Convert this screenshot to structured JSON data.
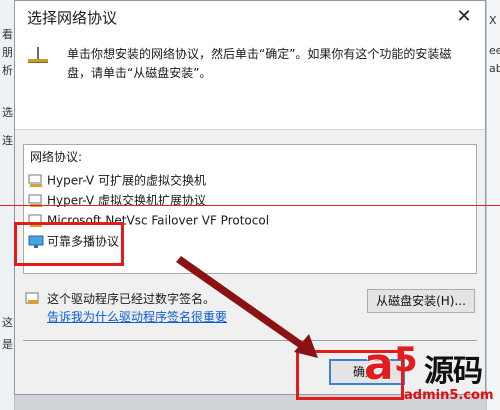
{
  "background": {
    "left_fragments": [
      "看",
      "朋",
      "析",
      "选",
      "连"
    ],
    "left_lower_fragments": [
      "这",
      "是"
    ],
    "right_fragments": [
      "X",
      "ee",
      "ab"
    ]
  },
  "dialog": {
    "title": "选择网络协议",
    "close_glyph": "✕",
    "instruction": "单击你想安装的网络协议，然后单击“确定”。如果你有这个功能的安装磁盘，请单击“从磁盘安装”。",
    "list_header": "网络协议:",
    "protocols": [
      {
        "label": "Hyper-V 可扩展的虚拟交换机"
      },
      {
        "label": "Hyper-V 虚拟交换机扩展协议"
      },
      {
        "label": "Microsoft NetVsc Failover VF Protocol"
      },
      {
        "label": "可靠多播协议"
      }
    ],
    "signature_text": "这个驱动程序已经过数字签名。",
    "signature_link": "告诉我为什么驱动程序签名很重要",
    "disk_button": "从磁盘安装(H)...",
    "ok_button": "确定"
  },
  "watermark": {
    "letter_a": "a",
    "digit": "5",
    "chinese": "源码",
    "url": "admin5.com"
  },
  "colors": {
    "highlight": "#e41b1b",
    "link": "#0b5cd6",
    "ok_border": "#3b82d6"
  }
}
